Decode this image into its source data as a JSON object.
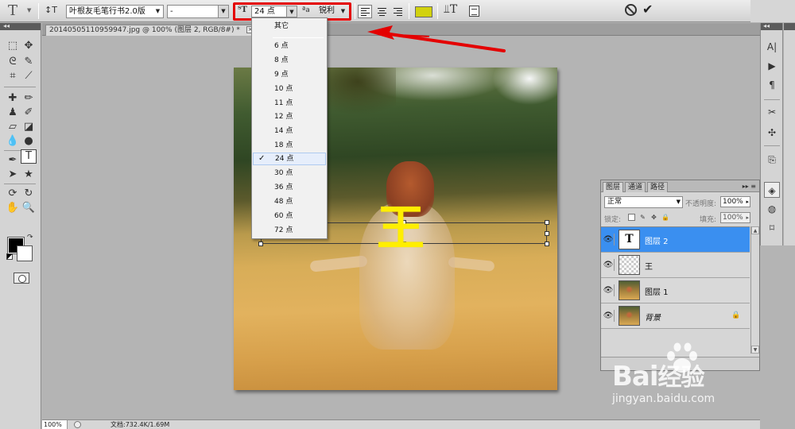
{
  "options_bar": {
    "font_family": "叶根友毛笔行书2.0版",
    "font_style": "-",
    "font_size": "24 点",
    "antialias": "锐利",
    "text_color": "#d2d20e",
    "size_highlight_color": "#e40000"
  },
  "document": {
    "tab_title": "20140505110959947.jpg @ 100% (图层 2, RGB/8#) *",
    "close_label": "×"
  },
  "size_menu": {
    "items": [
      "其它",
      "6 点",
      "8 点",
      "9 点",
      "10 点",
      "11 点",
      "12 点",
      "14 点",
      "18 点",
      "24 点",
      "30 点",
      "36 点",
      "48 点",
      "60 点",
      "72 点"
    ],
    "selected": "24 点",
    "check_mark": "✓"
  },
  "canvas_text": {
    "glyph": "王",
    "color": "#ffee00"
  },
  "layers_panel": {
    "tabs": [
      "图层",
      "通道",
      "路径"
    ],
    "active_tab": "图层",
    "blend_mode": "正常",
    "opacity_label": "不透明度:",
    "opacity_value": "100%",
    "lock_label": "锁定:",
    "fill_label": "填充:",
    "fill_value": "100%",
    "layers": [
      {
        "name": "图层 2",
        "thumb": "T",
        "type": "text",
        "selected": true
      },
      {
        "name": "王",
        "thumb": "",
        "type": "transparent",
        "selected": false
      },
      {
        "name": "图层 1",
        "thumb": "",
        "type": "image",
        "selected": false
      },
      {
        "name": "背景",
        "thumb": "",
        "type": "background",
        "selected": false,
        "locked": true
      }
    ],
    "selected_color": "#3a8ff0"
  },
  "status_bar": {
    "zoom": "100%",
    "doc_info": "文档:732.4K/1.69M"
  },
  "watermark": {
    "logo": "Bai",
    "logo_tail": "经验",
    "url": "jingyan.baidu.com"
  }
}
